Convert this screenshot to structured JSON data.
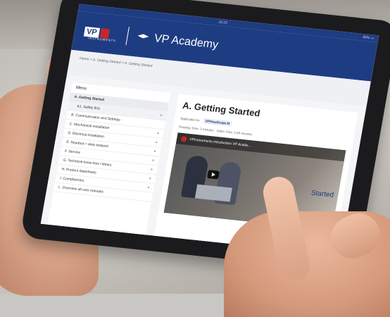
{
  "statusbar": {
    "left": "",
    "center": "10:15",
    "right": "88% ▭"
  },
  "header": {
    "logo_text": "VP",
    "logo_sub": "INSTRUMENTS",
    "title": "VP Academy"
  },
  "breadcrumb": "Home > A. Getting Started > A. Getting Started",
  "menu": {
    "title": "Menu",
    "items": [
      {
        "label": "A. Getting Started",
        "active": true
      },
      {
        "label": "A1. Safety first",
        "sub": true
      },
      {
        "label": "B. Communication and Settings"
      },
      {
        "label": "C. Mechanical installation"
      },
      {
        "label": "D. Electrical installation"
      },
      {
        "label": "E. Readout + data analysis"
      },
      {
        "label": "F. Service"
      },
      {
        "label": "G. Technical know-how / library"
      },
      {
        "label": "H. Product datasheets"
      },
      {
        "label": "I. Compliancies"
      },
      {
        "label": "L. Overview all user manuals"
      }
    ]
  },
  "main": {
    "title": "A. Getting Started",
    "applicable_label": "Applicable for:",
    "applicable_tag": "VPFlowScope M",
    "reading_time": "Reading Time: 2 minutes",
    "video_time": "Video Time: 2:40 minutes",
    "video_title": "VPInstruments introduction VP Acade...",
    "side_text": "Started"
  }
}
